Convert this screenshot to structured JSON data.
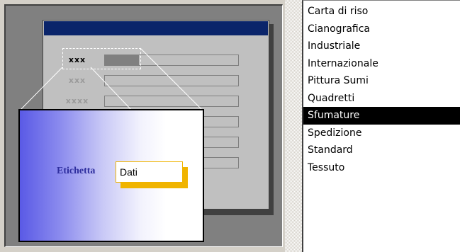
{
  "preview": {
    "row_labels": [
      "xxx",
      "xxx",
      "xxxx",
      "",
      "",
      ""
    ],
    "card_label": "Etichetta",
    "card_data": "Dati",
    "colors": {
      "title_bar": "#0a246a",
      "card_gradient_start": "#5a5ae6",
      "card_label_text": "#2e2e9e",
      "data_accent": "#f0b400"
    }
  },
  "style_list": {
    "items": [
      "Carta di riso",
      "Cianografica",
      "Industriale",
      "Internazionale",
      "Pittura Sumi",
      "Quadretti",
      "Sfumature",
      "Spedizione",
      "Standard",
      "Tessuto"
    ],
    "selected": "Sfumature"
  }
}
